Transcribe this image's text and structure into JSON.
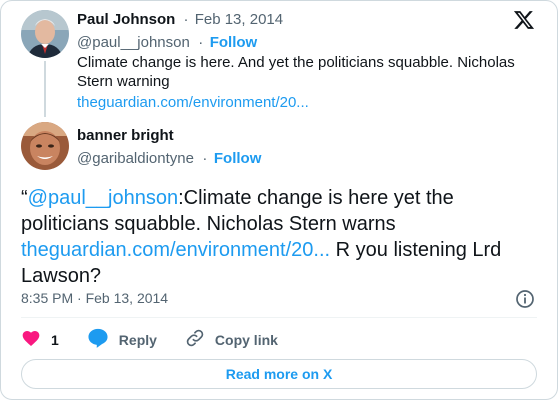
{
  "parent_tweet": {
    "author_name": "Paul Johnson",
    "date_sep": "·",
    "date": "Feb 13, 2014",
    "handle": "@paul__johnson",
    "handle_sep": "·",
    "follow_label": "Follow",
    "text": "Climate change is here. And yet the politicians squabble. Nicholas Stern warning",
    "link": "theguardian.com/environment/20..."
  },
  "main_tweet": {
    "author_name": "banner bright",
    "handle": "@garibaldiontyne",
    "handle_sep": "·",
    "follow_label": "Follow",
    "quote_open": "“",
    "mention": "@paul__johnson",
    "text_part1": ":Climate change is here yet the politicians squabble. Nicholas Stern warns ",
    "link": "theguardian.com/environment/20...",
    "text_part2": " R you listening Lrd Lawson?",
    "timestamp": "8:35 PM · Feb 13, 2014"
  },
  "actions": {
    "like_count": "1",
    "reply_label": "Reply",
    "copy_link_label": "Copy link"
  },
  "read_more_label": "Read more on X",
  "colors": {
    "accent": "#1d9bf0",
    "like": "#f91880",
    "text": "#0f1419",
    "muted": "#536471"
  },
  "icons": [
    "x-logo-icon",
    "heart-icon",
    "reply-icon",
    "link-icon",
    "info-icon"
  ]
}
